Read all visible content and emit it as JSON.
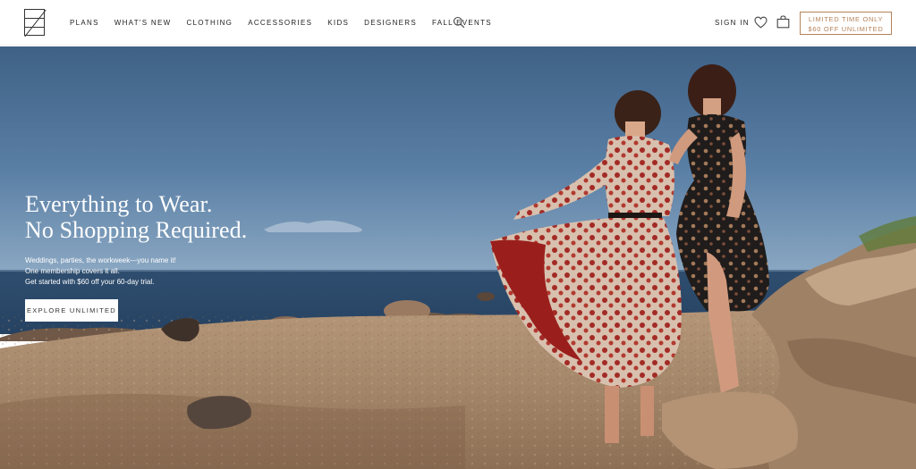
{
  "header": {
    "logo_icon": "rtr-logo-icon",
    "nav": [
      {
        "label": "PLANS"
      },
      {
        "label": "WHAT'S NEW"
      },
      {
        "label": "CLOTHING"
      },
      {
        "label": "ACCESSORIES"
      },
      {
        "label": "KIDS"
      },
      {
        "label": "DESIGNERS"
      },
      {
        "label": "FALL EVENTS"
      }
    ],
    "search_icon": "search-icon",
    "sign_in_label": "SIGN IN",
    "heart_icon": "heart-icon",
    "bag_icon": "shopping-bag-icon",
    "promo": {
      "line1": "LIMITED TIME ONLY",
      "line2": "$60 OFF UNLIMITED",
      "color": "#b5835a"
    }
  },
  "hero": {
    "headline_line1": "Everything to Wear.",
    "headline_line2": "No Shopping Required.",
    "subcopy": [
      "Weddings, parties, the workweek—you name it!",
      "One membership covers it all.",
      "Get started with $60 off your 60-day trial."
    ],
    "cta_label": "EXPLORE UNLIMITED",
    "colors": {
      "sky": "#4a6e94",
      "sea": "#2b4a6b",
      "shore": "#a98a6a"
    }
  }
}
